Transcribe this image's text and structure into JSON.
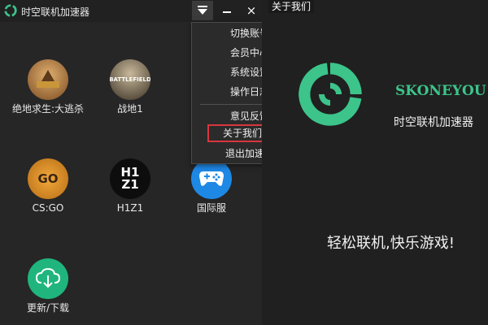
{
  "app": {
    "title": "时空联机加速器",
    "window_buttons": {
      "menu": "menu-icon",
      "minimize": "minimize-icon",
      "close": "×"
    }
  },
  "games": [
    {
      "label": "绝地求生:大逃杀",
      "icon": "pubg-icon"
    },
    {
      "label": "战地1",
      "icon": "battlefield-icon"
    },
    {
      "label": "CS:GO",
      "icon": "csgo-icon"
    },
    {
      "label": "H1Z1",
      "icon": "h1z1-icon"
    },
    {
      "label": "国际服",
      "icon": "gamepad-icon"
    },
    {
      "label": "更新/下载",
      "icon": "cloud-download-icon"
    }
  ],
  "icon_text": {
    "csgo": "GO",
    "h1z1_top": "H1",
    "h1z1_bottom": "Z1",
    "battlefield": "BATTLEFIELD"
  },
  "menu": {
    "items": [
      "切换账号",
      "会员中心",
      "系统设置",
      "操作日志",
      "意见反馈",
      "关于我们",
      "退出加速器"
    ],
    "highlighted": "关于我们"
  },
  "splash": {
    "window_title": "关于我们",
    "brand_en": "SKONEYOU",
    "brand_cn": "时空联机加速器",
    "slogan": "轻松联机,快乐游戏!"
  },
  "colors": {
    "brand_green": "#3cc48a",
    "highlight_border": "#d9363e",
    "gamepad_blue": "#1e88e5",
    "download_green": "#1fb57d"
  }
}
